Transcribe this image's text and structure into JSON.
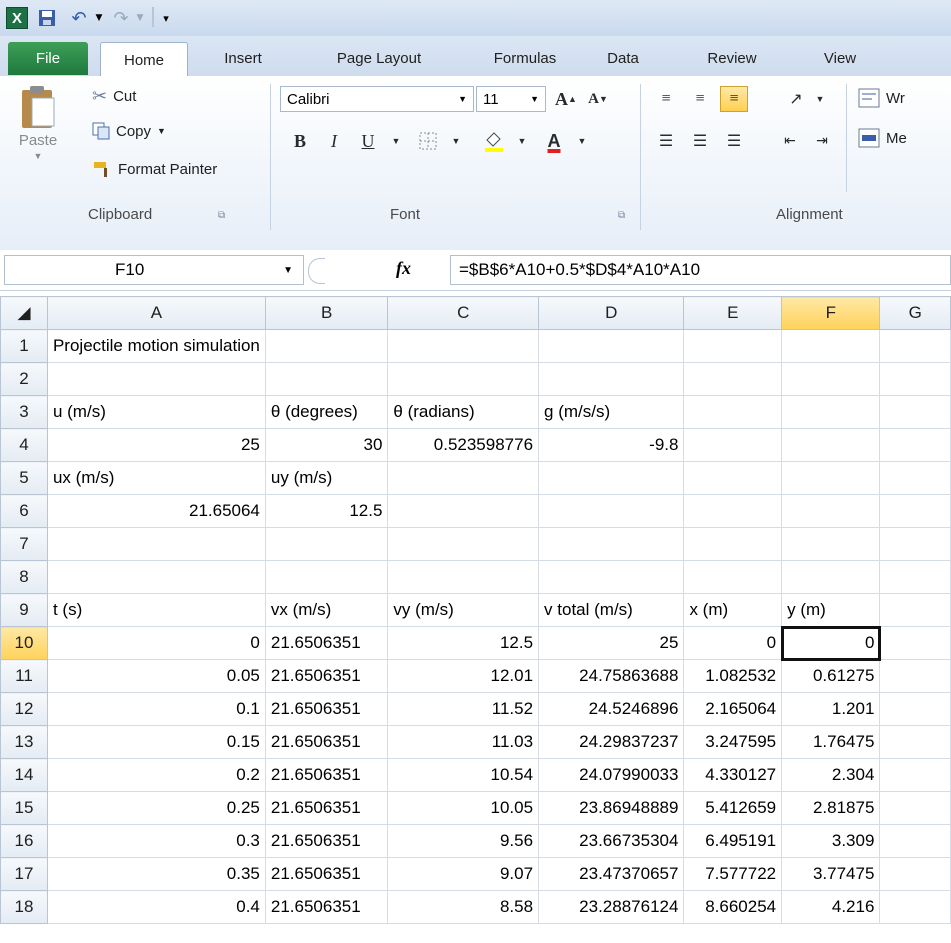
{
  "quick_access": {
    "logo": "X"
  },
  "tabs": [
    "File",
    "Home",
    "Insert",
    "Page Layout",
    "Formulas",
    "Data",
    "Review",
    "View"
  ],
  "ribbon": {
    "clipboard": {
      "paste": "Paste",
      "cut": "Cut",
      "copy": "Copy",
      "format_painter": "Format Painter",
      "label": "Clipboard"
    },
    "font": {
      "name": "Calibri",
      "size": "11",
      "label": "Font",
      "bold": "B",
      "italic": "I",
      "underline": "U"
    },
    "alignment": {
      "label": "Alignment",
      "wrap": "Wr",
      "merge": "Me"
    }
  },
  "formula_bar": {
    "name_box": "F10",
    "fx": "fx",
    "formula": "=$B$6*A10+0.5*$D$4*A10*A10"
  },
  "columns": [
    "A",
    "B",
    "C",
    "D",
    "E",
    "F",
    "G"
  ],
  "selected_column": "F",
  "active_row": "10",
  "rows": [
    {
      "n": "1",
      "cells": [
        "Projectile motion simulation",
        "",
        "",
        "",
        "",
        "",
        ""
      ]
    },
    {
      "n": "2",
      "cells": [
        "",
        "",
        "",
        "",
        "",
        "",
        ""
      ]
    },
    {
      "n": "3",
      "cells": [
        "u (m/s)",
        "θ (degrees)",
        "θ (radians)",
        "g (m/s/s)",
        "",
        "",
        ""
      ]
    },
    {
      "n": "4",
      "cells": [
        "25",
        "30",
        "0.523598776",
        "-9.8",
        "",
        "",
        ""
      ]
    },
    {
      "n": "5",
      "cells": [
        "ux  (m/s)",
        "uy  (m/s)",
        "",
        "",
        "",
        "",
        ""
      ]
    },
    {
      "n": "6",
      "cells": [
        "21.65064",
        "12.5",
        "",
        "",
        "",
        "",
        ""
      ]
    },
    {
      "n": "7",
      "cells": [
        "",
        "",
        "",
        "",
        "",
        "",
        ""
      ]
    },
    {
      "n": "8",
      "cells": [
        "",
        "",
        "",
        "",
        "",
        "",
        ""
      ]
    },
    {
      "n": "9",
      "cells": [
        "t (s)",
        "vx (m/s)",
        "vy (m/s)",
        "v total (m/s)",
        "x (m)",
        "y (m)",
        ""
      ]
    },
    {
      "n": "10",
      "cells": [
        "0",
        "21.6506351",
        "12.5",
        "25",
        "0",
        "0",
        ""
      ]
    },
    {
      "n": "11",
      "cells": [
        "0.05",
        "21.6506351",
        "12.01",
        "24.75863688",
        "1.082532",
        "0.61275",
        ""
      ]
    },
    {
      "n": "12",
      "cells": [
        "0.1",
        "21.6506351",
        "11.52",
        "24.5246896",
        "2.165064",
        "1.201",
        ""
      ]
    },
    {
      "n": "13",
      "cells": [
        "0.15",
        "21.6506351",
        "11.03",
        "24.29837237",
        "3.247595",
        "1.76475",
        ""
      ]
    },
    {
      "n": "14",
      "cells": [
        "0.2",
        "21.6506351",
        "10.54",
        "24.07990033",
        "4.330127",
        "2.304",
        ""
      ]
    },
    {
      "n": "15",
      "cells": [
        "0.25",
        "21.6506351",
        "10.05",
        "23.86948889",
        "5.412659",
        "2.81875",
        ""
      ]
    },
    {
      "n": "16",
      "cells": [
        "0.3",
        "21.6506351",
        "9.56",
        "23.66735304",
        "6.495191",
        "3.309",
        ""
      ]
    },
    {
      "n": "17",
      "cells": [
        "0.35",
        "21.6506351",
        "9.07",
        "23.47370657",
        "7.577722",
        "3.77475",
        ""
      ]
    },
    {
      "n": "18",
      "cells": [
        "0.4",
        "21.6506351",
        "8.58",
        "23.28876124",
        "8.660254",
        "4.216",
        ""
      ]
    }
  ]
}
